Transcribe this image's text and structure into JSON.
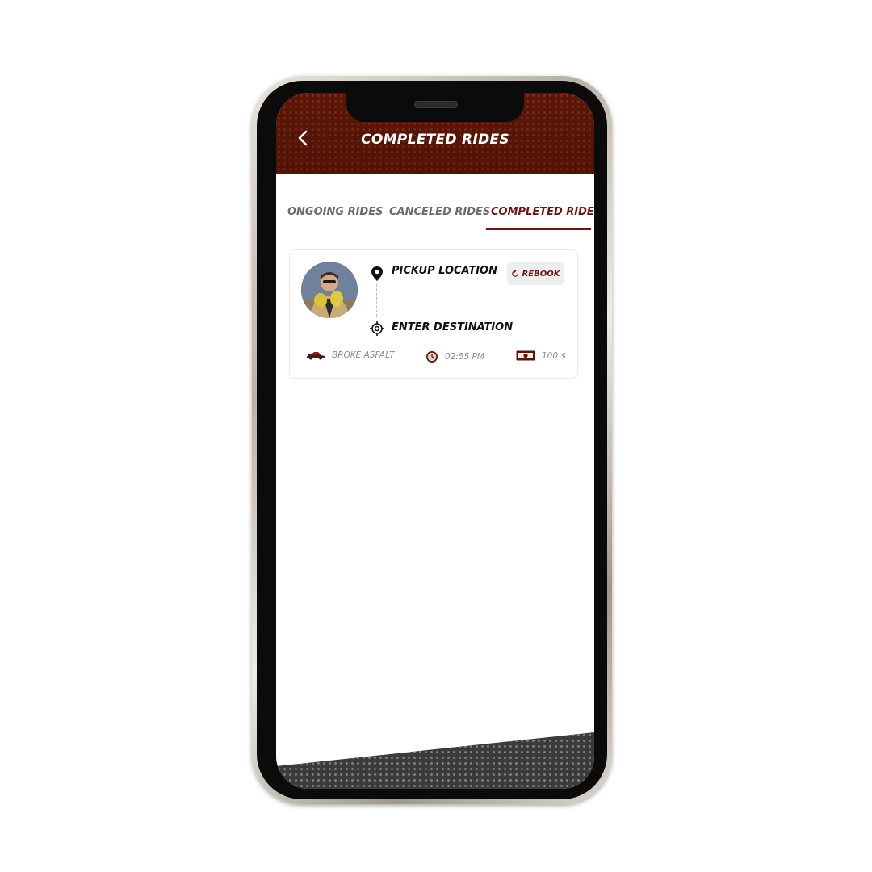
{
  "header": {
    "title": "COMPLETED RIDES",
    "back_icon": "chevron-left-icon"
  },
  "tabs": [
    {
      "label": "ONGOING RIDES",
      "active": false
    },
    {
      "label": "CANCELED RIDES",
      "active": false
    },
    {
      "label": "COMPLETED RIDES",
      "active": true
    }
  ],
  "ride": {
    "pickup": "PICKUP LOCATION",
    "destination": "ENTER DESTINATION",
    "rebook_label": "REBOOK",
    "car": "BROKE ASFALT",
    "time": "02:55 PM",
    "price": "100 $"
  },
  "colors": {
    "header": "#5a1708",
    "accent": "#6b1515",
    "muted_text": "#8a8a8a"
  }
}
